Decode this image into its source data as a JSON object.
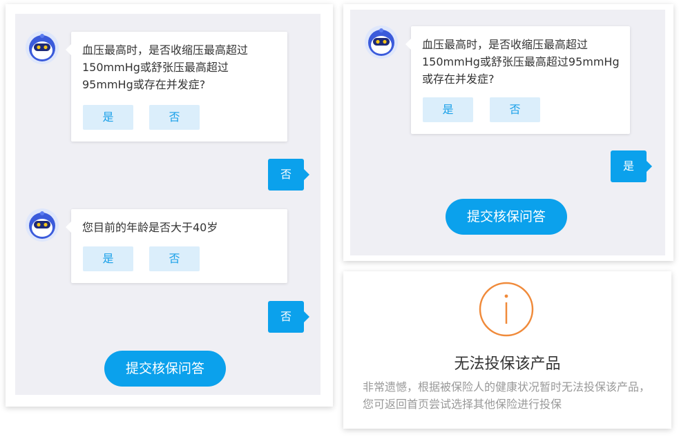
{
  "left_panel": {
    "question1": {
      "text": "血压最高时，是否收缩压最高超过150mmHg或舒张压最高超过95mmHg或存在并发症?",
      "yes_label": "是",
      "no_label": "否"
    },
    "reply1": "否",
    "question2": {
      "text": "您目前的年龄是否大于40岁",
      "yes_label": "是",
      "no_label": "否"
    },
    "reply2": "否",
    "submit_label": "提交核保问答"
  },
  "right_panel": {
    "question1": {
      "text": "血压最高时，是否收缩压最高超过150mmHg或舒张压最高超过95mmHg或存在并发症?",
      "yes_label": "是",
      "no_label": "否"
    },
    "reply1": "是",
    "submit_label": "提交核保问答"
  },
  "result_panel": {
    "icon": "info-circle-icon",
    "icon_color": "#f08a3a",
    "title": "无法投保该产品",
    "description": "非常遗憾，根据被保险人的健康状况暂时无法投保该产品，您可返回首页尝试选择其他保险进行投保"
  },
  "colors": {
    "accent": "#0ba1ec",
    "option_bg": "#dbeefb",
    "chat_bg": "#efeff4"
  }
}
